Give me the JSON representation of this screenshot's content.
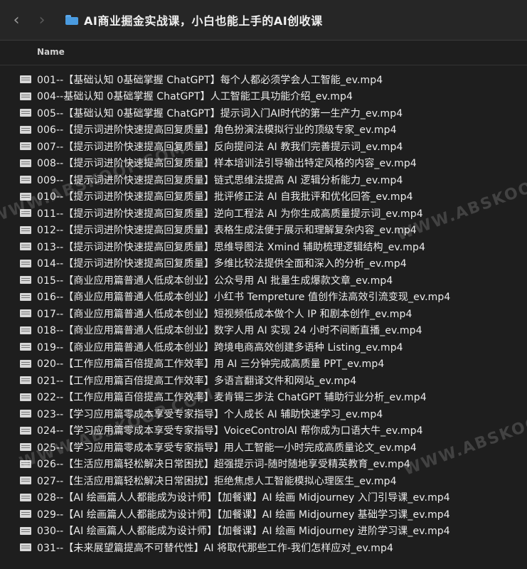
{
  "toolbar": {
    "back_icon": "chevron-left-icon",
    "forward_icon": "chevron-right-icon",
    "folder_icon": "folder-icon",
    "title": "AI商业掘金实战课，小白也能上手的AI创收课"
  },
  "list": {
    "column_name": "Name",
    "file_icon": "video-file-icon",
    "files": [
      "001--【基础认知 0基础掌握 ChatGPT】每个人都必须学会人工智能_ev.mp4",
      "004--基础认知 0基础掌握 ChatGPT】人工智能工具功能介绍_ev.mp4",
      "005--【基础认知 0基础掌握 ChatGPT】提示词入门AI时代的第一生产力_ev.mp4",
      "006--【提示词进阶快速提高回复质量】角色扮演法模拟行业的顶级专家_ev.mp4",
      "007--【提示词进阶快速提高回复质量】反向提问法 AI 教我们完善提示词_ev.mp4",
      "008--【提示词进阶快速提高回复质量】样本培训法引导输出特定风格的内容_ev.mp4",
      "009--【提示词进阶快速提高回复质量】链式思维法提高 AI 逻辑分析能力_ev.mp4",
      "010--【提示词进阶快速提高回复质量】批评修正法 AI 自我批评和优化回答_ev.mp4",
      "011--【提示词进阶快速提高回复质量】逆向工程法 AI 为你生成高质量提示词_ev.mp4",
      "012--【提示词进阶快速提高回复质量】表格生成法便于展示和理解复杂内容_ev.mp4",
      "013--【提示词进阶快速提高回复质量】思维导图法 Xmind 辅助梳理逻辑结构_ev.mp4",
      "014--【提示词进阶快速提高回复质量】多维比较法提供全面和深入的分析_ev.mp4",
      "015--【商业应用篇普通人低成本创业】公众号用 AI 批量生成爆款文章_ev.mp4",
      "016--【商业应用篇普通人低成本创业】小红书 Tempreture 值创作法高效引流变现_ev.mp4",
      "017--【商业应用篇普通人低成本创业】短视频低成本做个人 IP 和剧本创作_ev.mp4",
      "018--【商业应用篇普通人低成本创业】数字人用 AI 实现 24 小时不间断直播_ev.mp4",
      "019--【商业应用篇普通人低成本创业】跨境电商高效创建多语种 Listing_ev.mp4",
      "020--【工作应用篇百倍提高工作效率】用 AI 三分钟完成高质量 PPT_ev.mp4",
      "021--【工作应用篇百倍提高工作效率】多语言翻译文件和网站_ev.mp4",
      "022--【工作应用篇百倍提高工作效率】麦肯锡三步法 ChatGPT 辅助行业分析_ev.mp4",
      "023--【学习应用篇零成本享受专家指导】个人成长 AI 辅助快速学习_ev.mp4",
      "024--【学习应用篇零成本享受专家指导】VoiceControlAI 帮你成为口语大牛_ev.mp4",
      "025--【学习应用篇零成本享受专家指导】用人工智能一小时完成高质量论文_ev.mp4",
      "026--【生活应用篇轻松解决日常困扰】超强提示词-随时随地享受精英教育_ev.mp4",
      "027--【生活应用篇轻松解决日常困扰】拒绝焦虑人工智能模拟心理医生_ev.mp4",
      "028--【AI 绘画篇人人都能成为设计师】【加餐课】AI 绘画 Midjourney 入门引导课_ev.mp4",
      "029--【AI 绘画篇人人都能成为设计师】【加餐课】AI 绘画 Midjourney 基础学习课_ev.mp4",
      "030--【AI 绘画篇人人都能成为设计师】【加餐课】AI 绘画 Midjourney 进阶学习课_ev.mp4",
      "031--【未来展望篇提高不可替代性】AI 将取代那些工作-我们怎样应对_ev.mp4"
    ]
  },
  "watermarks": [
    "WWW.ABSKOOP.COM",
    "WWW.ABSKOOP.COM",
    "WWW.ABSKOOP.COM",
    "WWW.ABSKOOP.COM"
  ]
}
